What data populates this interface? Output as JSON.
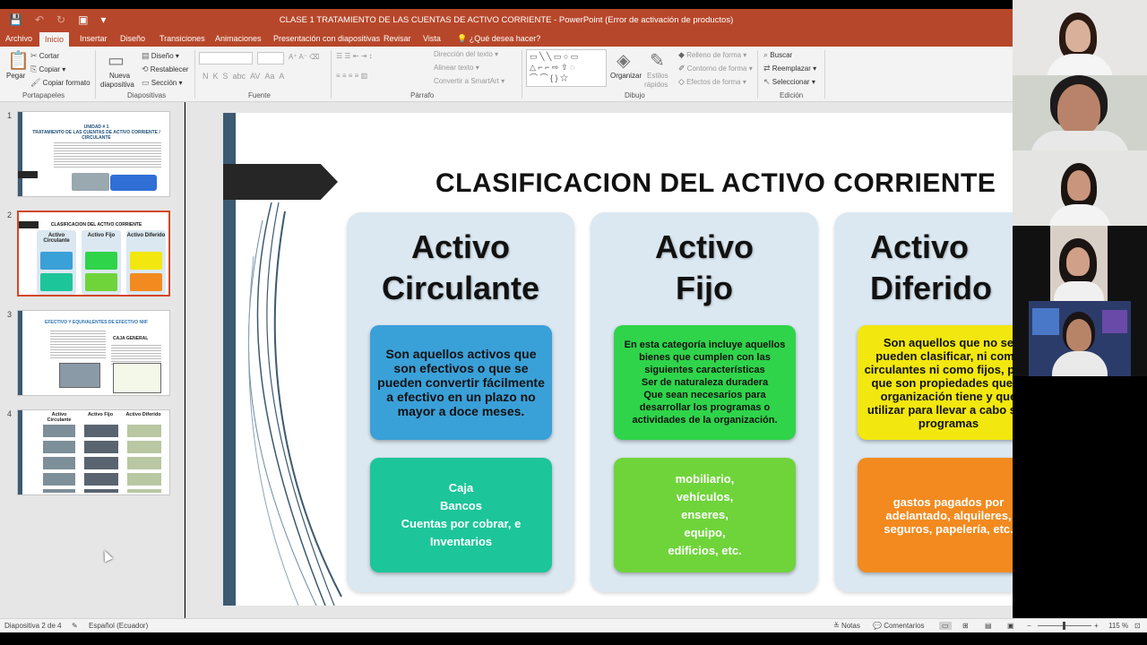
{
  "window": {
    "title": "CLASE 1 TRATAMIENTO DE LAS CUENTAS DE ACTIVO CORRIENTE - PowerPoint (Error de activación de productos)"
  },
  "quick_access": {
    "save_icon": "save-icon",
    "undo_icon": "undo-icon",
    "redo_icon": "redo-icon",
    "present_icon": "present-from-start-icon",
    "customize_icon": "chevron-down-icon"
  },
  "tabs": [
    {
      "label": "Archivo"
    },
    {
      "label": "Inicio"
    },
    {
      "label": "Insertar"
    },
    {
      "label": "Diseño"
    },
    {
      "label": "Transiciones"
    },
    {
      "label": "Animaciones"
    },
    {
      "label": "Presentación con diapositivas"
    },
    {
      "label": "Revisar"
    },
    {
      "label": "Vista"
    },
    {
      "label": "¿Qué desea hacer?"
    }
  ],
  "ribbon": {
    "clipboard": {
      "paste": "Pegar",
      "cut": "Cortar",
      "copy": "Copiar",
      "format_painter": "Copiar formato",
      "group": "Portapapeles"
    },
    "slides": {
      "new_slide": "Nueva",
      "new_slide_2": "diapositiva",
      "layout": "Diseño",
      "reset": "Restablecer",
      "section": "Sección",
      "group": "Diapositivas"
    },
    "font": {
      "group": "Fuente"
    },
    "paragraph": {
      "text_direction": "Dirección del texto",
      "align_text": "Alinear texto",
      "smartart": "Convertir a SmartArt",
      "group": "Párrafo"
    },
    "drawing": {
      "arrange": "Organizar",
      "quick_styles": "Estilos",
      "quick_styles_2": "rápidos",
      "shape_fill": "Relleno de forma",
      "shape_outline": "Contorno de forma",
      "shape_effects": "Efectos de forma",
      "group": "Dibujo"
    },
    "editing": {
      "find": "Buscar",
      "replace": "Reemplazar",
      "select": "Seleccionar",
      "group": "Edición"
    }
  },
  "thumbnails": [
    {
      "num": "1",
      "title": "UNIDAD # 1\nTRATAMIENTO DE LAS CUENTAS DE ACTIVO CORRIENTE / CIRCULANTE"
    },
    {
      "num": "2",
      "title": "CLASIFICACION DEL ACTIVO CORRIENTE",
      "cols": [
        "Activo Circulante",
        "Activo Fijo",
        "Activo Diferido"
      ]
    },
    {
      "num": "3",
      "title": "EFECTIVO Y EQUIVALENTES DE EFECTIVO NIIF",
      "sub": "CAJA GENERAL"
    },
    {
      "num": "4",
      "cols": [
        "Activo Circulante",
        "Activo Fijo",
        "Activo Diferido"
      ]
    }
  ],
  "slide": {
    "title": "CLASIFICACION DEL ACTIVO CORRIENTE",
    "columns": [
      {
        "heading": "Activo\nCirculante",
        "definition": "Son aquellos activos que son efectivos o que se pueden convertir fácilmente a efectivo en un plazo no mayor a doce meses.",
        "examples": "Caja\nBancos\nCuentas por cobrar, e\nInventarios",
        "def_color": "#3aa0d8",
        "ex_color": "#1cc59a"
      },
      {
        "heading": "Activo\nFijo",
        "definition": "En esta categoría incluye aquellos bienes que cumplen con las siguientes características\nSer de naturaleza duradera\nQue sean necesarios para desarrollar los programas o actividades de la organización.",
        "examples": "mobiliario,\nvehículos,\nenseres,\nequipo,\nedificios, etc.",
        "def_color": "#2fd44a",
        "ex_color": "#6fd43a"
      },
      {
        "heading": "Activo\nDiferido",
        "definition": "Son aquellos que no se pueden clasificar, ni como circulantes ni como fijos, pero que son propiedades que la organización tiene y que utilizar para llevar a cabo sus programas",
        "examples": "gastos pagados por adelantado, alquileres, seguros, papelería, etc.",
        "def_color": "#f2e70f",
        "ex_color": "#f28a1f"
      }
    ]
  },
  "statusbar": {
    "slide_info": "Diapositiva 2 de 4",
    "language": "Español (Ecuador)",
    "notes": "Notas",
    "comments": "Comentarios",
    "zoom": "115 %"
  }
}
